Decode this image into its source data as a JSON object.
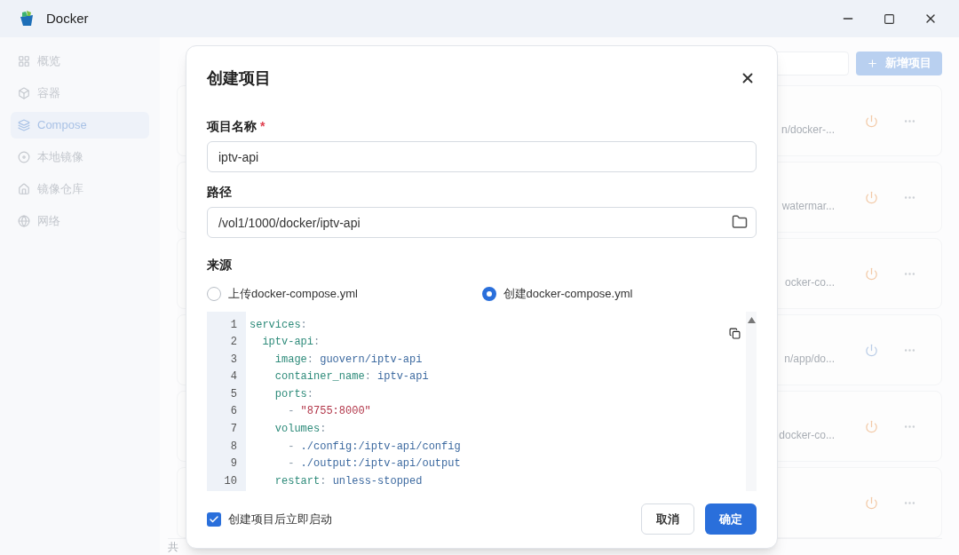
{
  "window": {
    "title": "Docker"
  },
  "sidebar": {
    "items": [
      {
        "label": "概览",
        "selected": false
      },
      {
        "label": "容器",
        "selected": false
      },
      {
        "label": "Compose",
        "selected": true
      },
      {
        "label": "本地镜像",
        "selected": false
      },
      {
        "label": "镜像仓库",
        "selected": false
      },
      {
        "label": "网络",
        "selected": false
      }
    ]
  },
  "content": {
    "add_button": "新增项目",
    "footer": "共",
    "cards": [
      {
        "path": "n/docker-...",
        "color": "#f2c9a6"
      },
      {
        "path": "watermar...",
        "color": "#f2c9a6"
      },
      {
        "path": "ocker-co...",
        "color": "#f2c9a6"
      },
      {
        "path": "n/app/do...",
        "color": "#b9cce6"
      },
      {
        "path": "docker-co...",
        "color": "#f2c9a6"
      },
      {
        "color": "#f2c9a6"
      }
    ]
  },
  "dialog": {
    "title": "创建项目",
    "name_label": "项目名称",
    "required_mark": "*",
    "name_value": "iptv-api",
    "path_label": "路径",
    "path_value": "/vol1/1000/docker/iptv-api",
    "source_label": "来源",
    "sources": [
      {
        "label": "上传docker-compose.yml",
        "selected": false
      },
      {
        "label": "创建docker-compose.yml",
        "selected": true
      }
    ],
    "code": [
      {
        "number": "1",
        "tokens": [
          {
            "text": "services",
            "kind": "key"
          },
          {
            "text": ":",
            "kind": "punct"
          }
        ]
      },
      {
        "number": "2",
        "tokens": [
          {
            "text": "  iptv-api",
            "kind": "key"
          },
          {
            "text": ":",
            "kind": "punct"
          }
        ]
      },
      {
        "number": "3",
        "tokens": [
          {
            "text": "    image",
            "kind": "key"
          },
          {
            "text": ": ",
            "kind": "punct"
          },
          {
            "text": "guovern/iptv-api",
            "kind": "value"
          }
        ]
      },
      {
        "number": "4",
        "tokens": [
          {
            "text": "    container_name",
            "kind": "key"
          },
          {
            "text": ": ",
            "kind": "punct"
          },
          {
            "text": "iptv-api",
            "kind": "value"
          }
        ]
      },
      {
        "number": "5",
        "tokens": [
          {
            "text": "    ports",
            "kind": "key"
          },
          {
            "text": ":",
            "kind": "punct"
          }
        ]
      },
      {
        "number": "6",
        "tokens": [
          {
            "text": "      - ",
            "kind": "punct"
          },
          {
            "text": "\"8755:8000\"",
            "kind": "string"
          }
        ]
      },
      {
        "number": "7",
        "tokens": [
          {
            "text": "    volumes",
            "kind": "key"
          },
          {
            "text": ":",
            "kind": "punct"
          }
        ]
      },
      {
        "number": "8",
        "tokens": [
          {
            "text": "      - ",
            "kind": "punct"
          },
          {
            "text": "./config:/iptv-api/config",
            "kind": "value"
          }
        ]
      },
      {
        "number": "9",
        "tokens": [
          {
            "text": "      - ",
            "kind": "punct"
          },
          {
            "text": "./output:/iptv-api/output",
            "kind": "value"
          }
        ]
      },
      {
        "number": "10",
        "tokens": [
          {
            "text": "    restart",
            "kind": "key"
          },
          {
            "text": ": ",
            "kind": "punct"
          },
          {
            "text": "unless-stopped",
            "kind": "value"
          }
        ]
      }
    ],
    "autostart": {
      "label": "创建项目后立即启动",
      "checked": true
    },
    "cancel": "取消",
    "confirm": "确定"
  }
}
